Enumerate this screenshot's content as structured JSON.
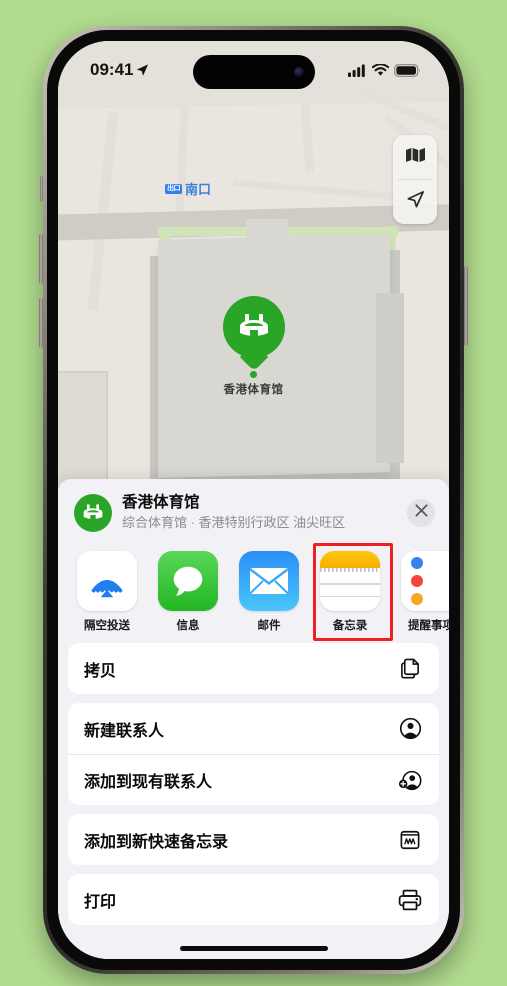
{
  "background_color": "#b2dd8f",
  "status_bar": {
    "time": "09:41",
    "location_arrow_icon": "location-arrow-icon",
    "cellular_icon": "cellular-signal-icon",
    "wifi_icon": "wifi-icon",
    "battery_icon": "battery-full-icon"
  },
  "map": {
    "pin_label": "香港体育馆",
    "pin_icon": "stadium-icon",
    "pin_color": "#2aa528",
    "transit_badge": "出口",
    "transit_label": "南口",
    "controls": {
      "layers_icon": "map-layers-icon",
      "locate_icon": "location-arrow-icon"
    }
  },
  "share_sheet": {
    "place": {
      "title": "香港体育馆",
      "subtitle": "综合体育馆 · 香港特别行政区 油尖旺区",
      "icon": "stadium-icon"
    },
    "close_label": "关闭",
    "apps": [
      {
        "label": "隔空投送",
        "icon": "airdrop-icon",
        "highlighted": false
      },
      {
        "label": "信息",
        "icon": "messages-icon",
        "highlighted": false
      },
      {
        "label": "邮件",
        "icon": "mail-icon",
        "highlighted": false
      },
      {
        "label": "备忘录",
        "icon": "notes-icon",
        "highlighted": true
      },
      {
        "label": "提醒事项",
        "icon": "reminders-icon",
        "highlighted": false
      }
    ],
    "highlight_color": "#f02020",
    "action_groups": [
      {
        "rows": [
          {
            "label": "拷贝",
            "icon": "copy-icon"
          }
        ]
      },
      {
        "rows": [
          {
            "label": "新建联系人",
            "icon": "person-circle-icon"
          },
          {
            "label": "添加到现有联系人",
            "icon": "person-add-icon"
          }
        ]
      },
      {
        "rows": [
          {
            "label": "添加到新快速备忘录",
            "icon": "quick-note-icon"
          }
        ]
      },
      {
        "rows": [
          {
            "label": "打印",
            "icon": "printer-icon"
          }
        ]
      }
    ]
  }
}
